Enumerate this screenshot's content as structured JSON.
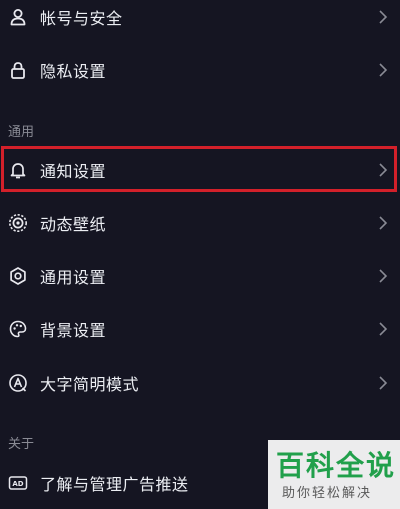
{
  "settings": {
    "top_items": [
      {
        "label": "帐号与安全",
        "icon": "person-icon"
      },
      {
        "label": "隐私设置",
        "icon": "lock-icon"
      }
    ],
    "general_section_title": "通用",
    "general_items": [
      {
        "label": "通知设置",
        "icon": "bell-icon",
        "highlighted": true
      },
      {
        "label": "动态壁纸",
        "icon": "live-wallpaper-icon"
      },
      {
        "label": "通用设置",
        "icon": "gear-icon"
      },
      {
        "label": "背景设置",
        "icon": "palette-icon"
      },
      {
        "label": "大字简明模式",
        "icon": "font-size-icon"
      }
    ],
    "about_section_title": "关于",
    "about_items": [
      {
        "label": "了解与管理广告推送",
        "icon": "ad-icon"
      }
    ]
  },
  "watermark": {
    "title": "百科全说",
    "subtitle": "助你轻松解决"
  },
  "colors": {
    "background": "#151522",
    "highlight_border": "#d3202a",
    "watermark_green": "#21a04b"
  }
}
